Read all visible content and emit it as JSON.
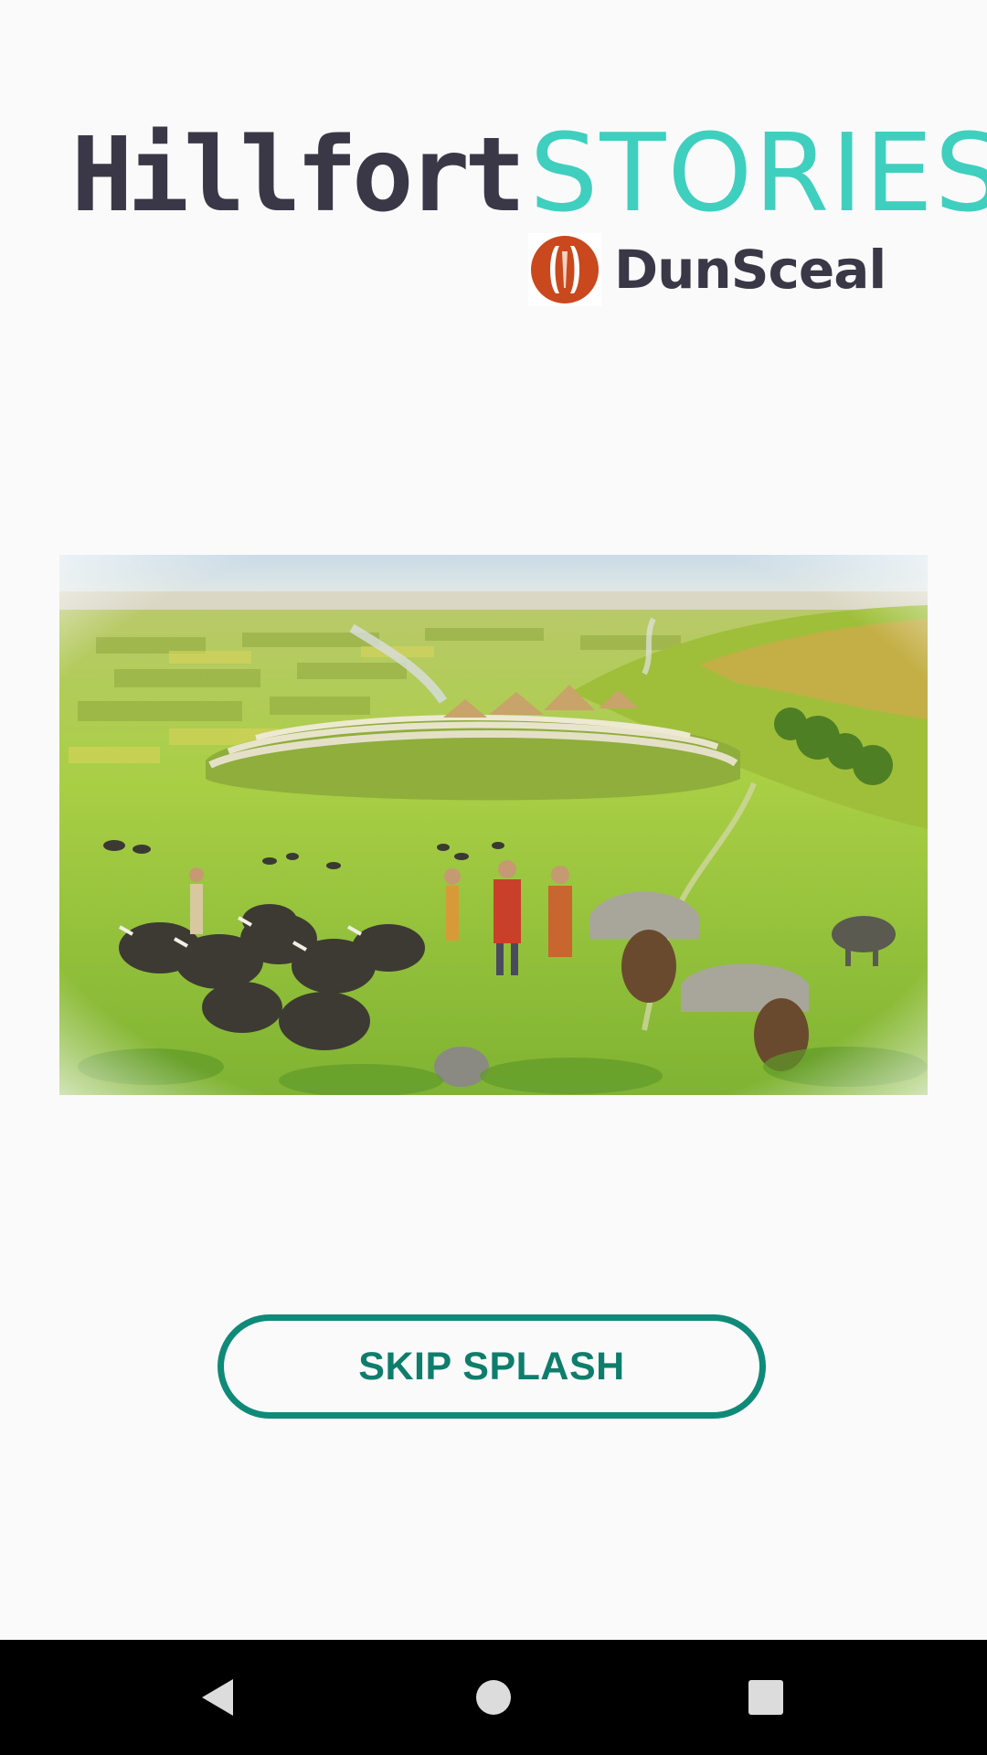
{
  "logo": {
    "word1": "Hillfort",
    "word2": "STORIES",
    "sub_brand": "DunSceal",
    "colors": {
      "dark": "#3a3847",
      "teal": "#3fcfbf",
      "emblem": "#c9481d"
    }
  },
  "illustration": {
    "subject": "hillfort-scene"
  },
  "skip_button": {
    "label": "SKIP SPLASH",
    "border_color": "#0f8a78",
    "text_color": "#0f7d6c"
  },
  "navbar": {
    "back_icon": "back-triangle-icon",
    "home_icon": "home-circle-icon",
    "recents_icon": "recents-square-icon"
  }
}
